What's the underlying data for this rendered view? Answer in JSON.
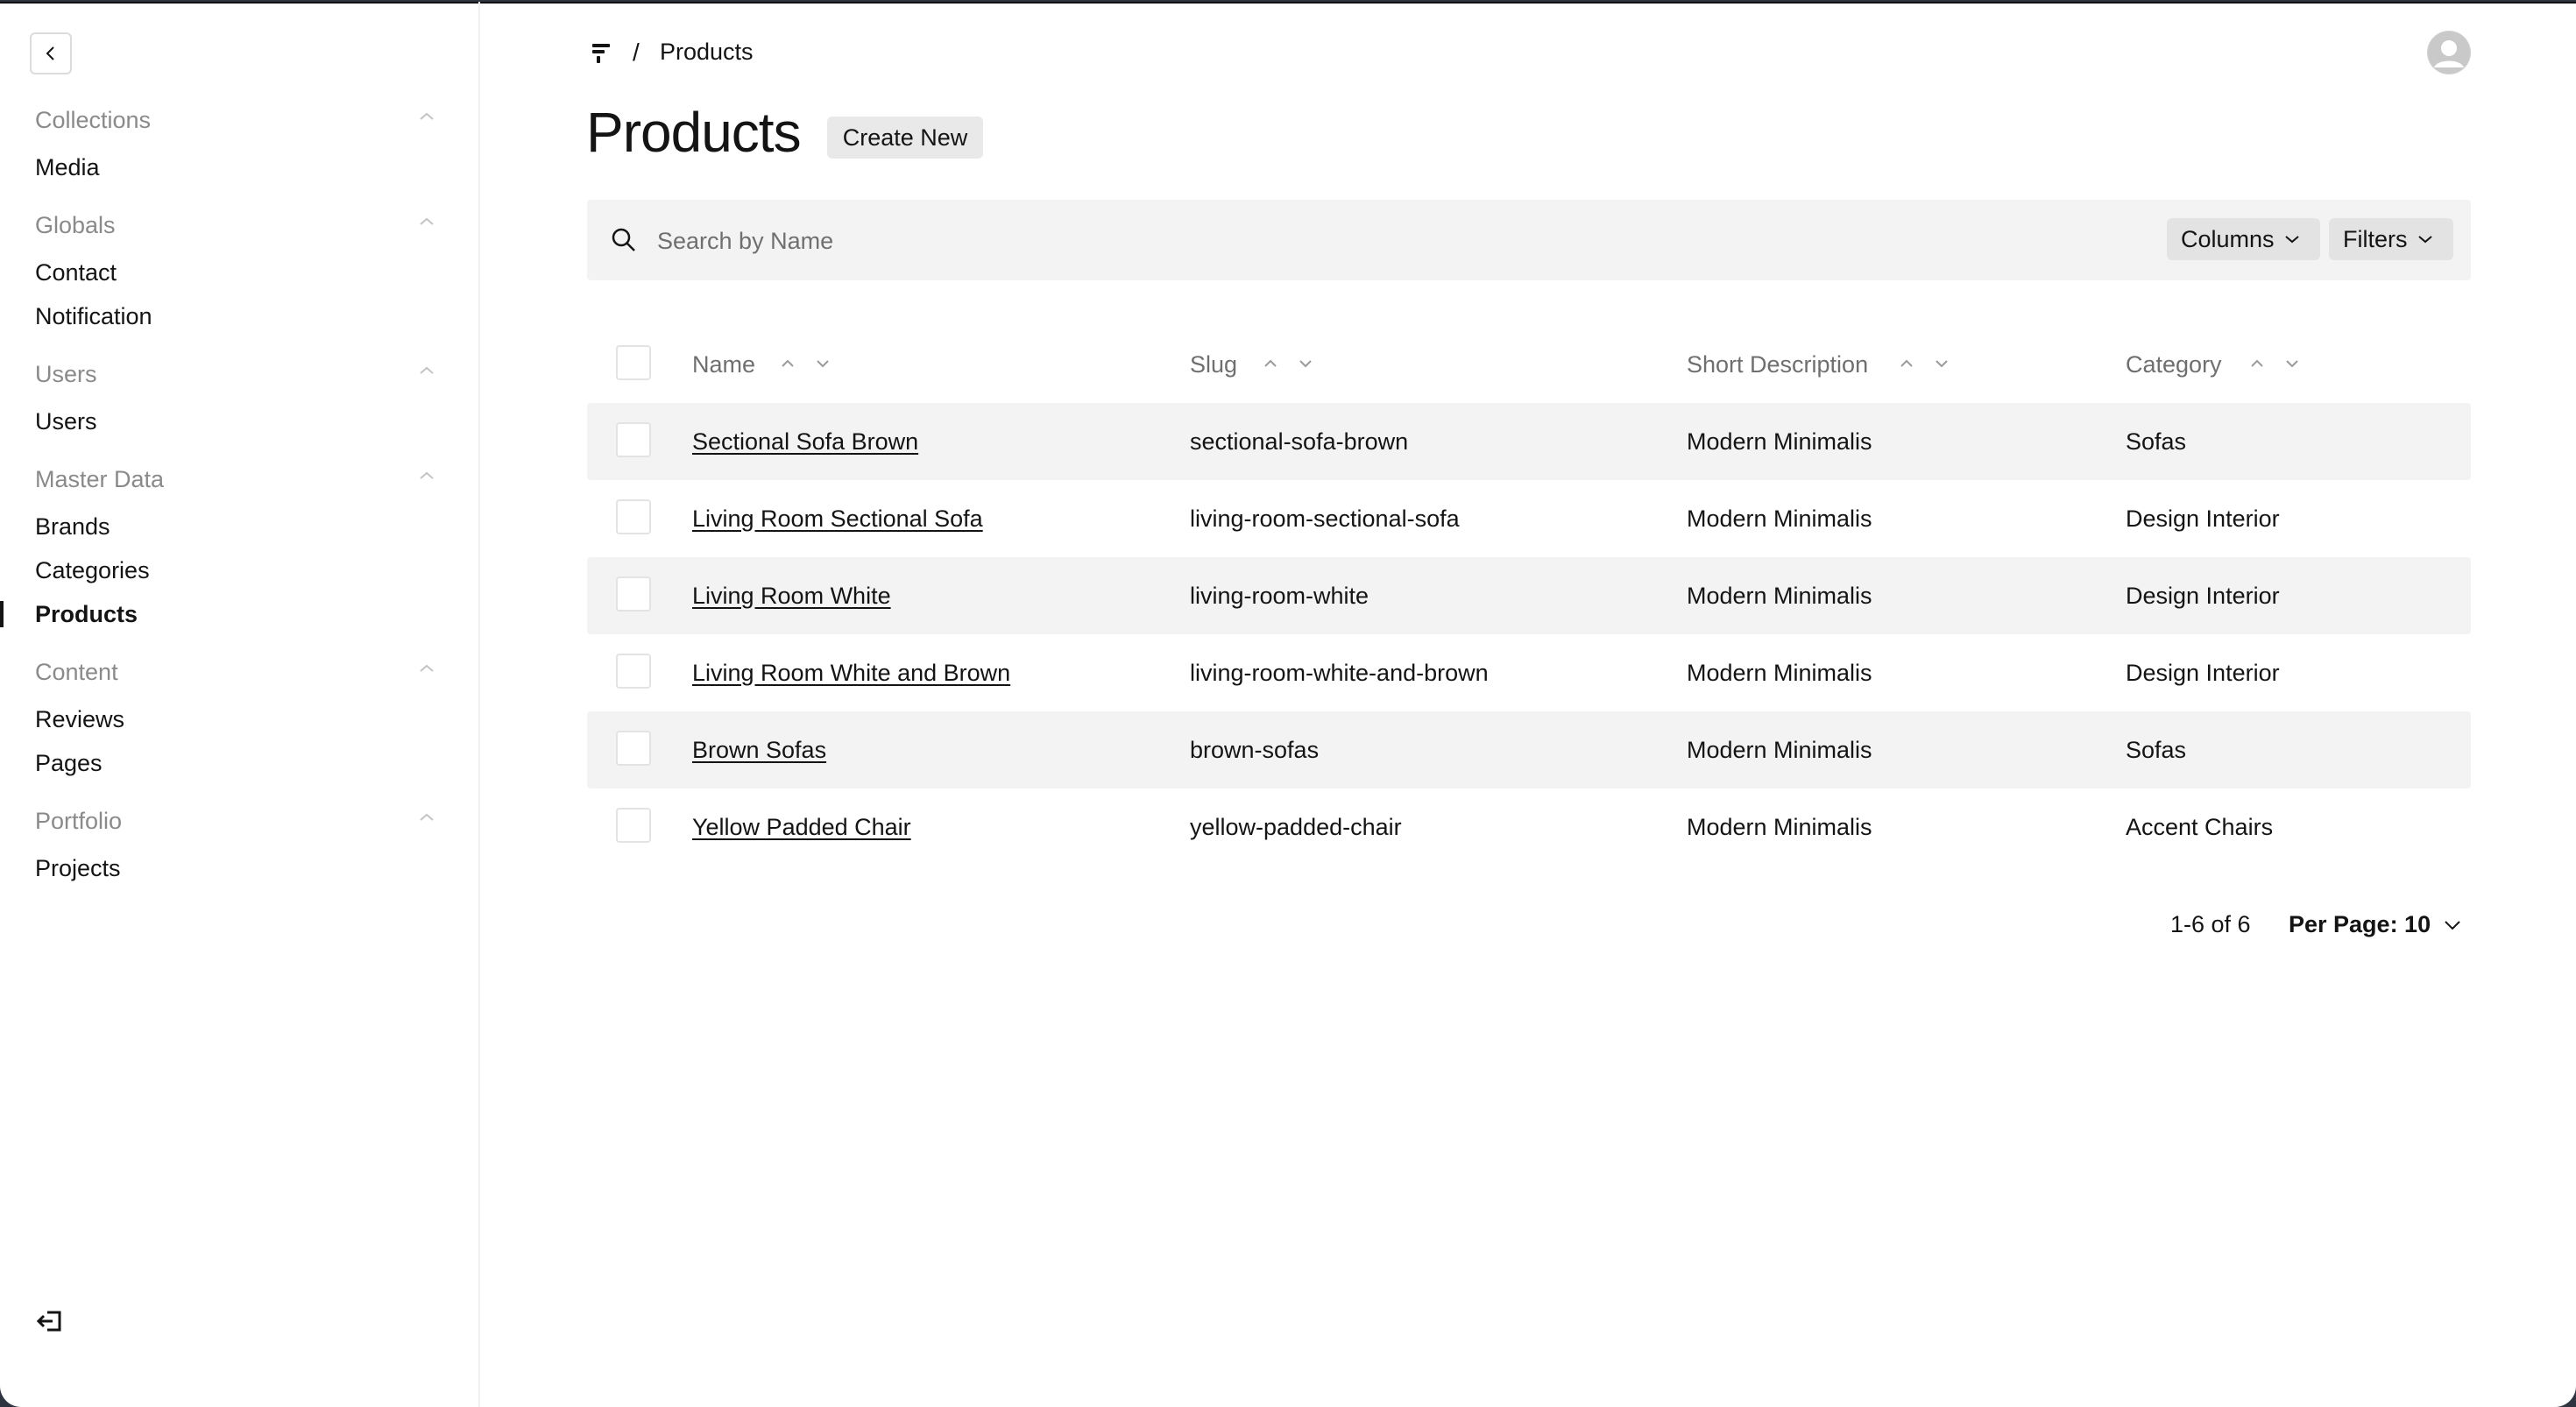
{
  "sidebar": {
    "groups": [
      {
        "label": "Collections",
        "items": [
          {
            "label": "Media"
          }
        ]
      },
      {
        "label": "Globals",
        "items": [
          {
            "label": "Contact"
          },
          {
            "label": "Notification"
          }
        ]
      },
      {
        "label": "Users",
        "items": [
          {
            "label": "Users"
          }
        ]
      },
      {
        "label": "Master Data",
        "items": [
          {
            "label": "Brands"
          },
          {
            "label": "Categories"
          },
          {
            "label": "Products",
            "active": true
          }
        ]
      },
      {
        "label": "Content",
        "items": [
          {
            "label": "Reviews"
          },
          {
            "label": "Pages"
          }
        ]
      },
      {
        "label": "Portfolio",
        "items": [
          {
            "label": "Projects"
          }
        ]
      }
    ]
  },
  "breadcrumb": {
    "separator": "/",
    "current": "Products"
  },
  "header": {
    "title": "Products",
    "create_label": "Create New"
  },
  "search": {
    "placeholder": "Search by Name",
    "columns_label": "Columns",
    "filters_label": "Filters"
  },
  "table": {
    "columns": [
      "Name",
      "Slug",
      "Short Description",
      "Category"
    ],
    "rows": [
      {
        "name": "Sectional Sofa Brown",
        "slug": "sectional-sofa-brown",
        "description": "Modern Minimalis",
        "category": "Sofas"
      },
      {
        "name": "Living Room Sectional Sofa",
        "slug": "living-room-sectional-sofa",
        "description": "Modern Minimalis",
        "category": "Design Interior"
      },
      {
        "name": "Living Room White",
        "slug": "living-room-white",
        "description": "Modern Minimalis",
        "category": "Design Interior"
      },
      {
        "name": "Living Room White and Brown",
        "slug": "living-room-white-and-brown",
        "description": "Modern Minimalis",
        "category": "Design Interior"
      },
      {
        "name": "Brown Sofas",
        "slug": "brown-sofas",
        "description": "Modern Minimalis",
        "category": "Sofas"
      },
      {
        "name": "Yellow Padded Chair",
        "slug": "yellow-padded-chair",
        "description": "Modern Minimalis",
        "category": "Accent Chairs"
      }
    ]
  },
  "pagination": {
    "count_label": "1-6 of 6",
    "per_page_label": "Per Page: 10"
  },
  "colors": {
    "row_alt": "#f3f3f3",
    "text": "#141414",
    "muted": "#8a8a8a"
  }
}
